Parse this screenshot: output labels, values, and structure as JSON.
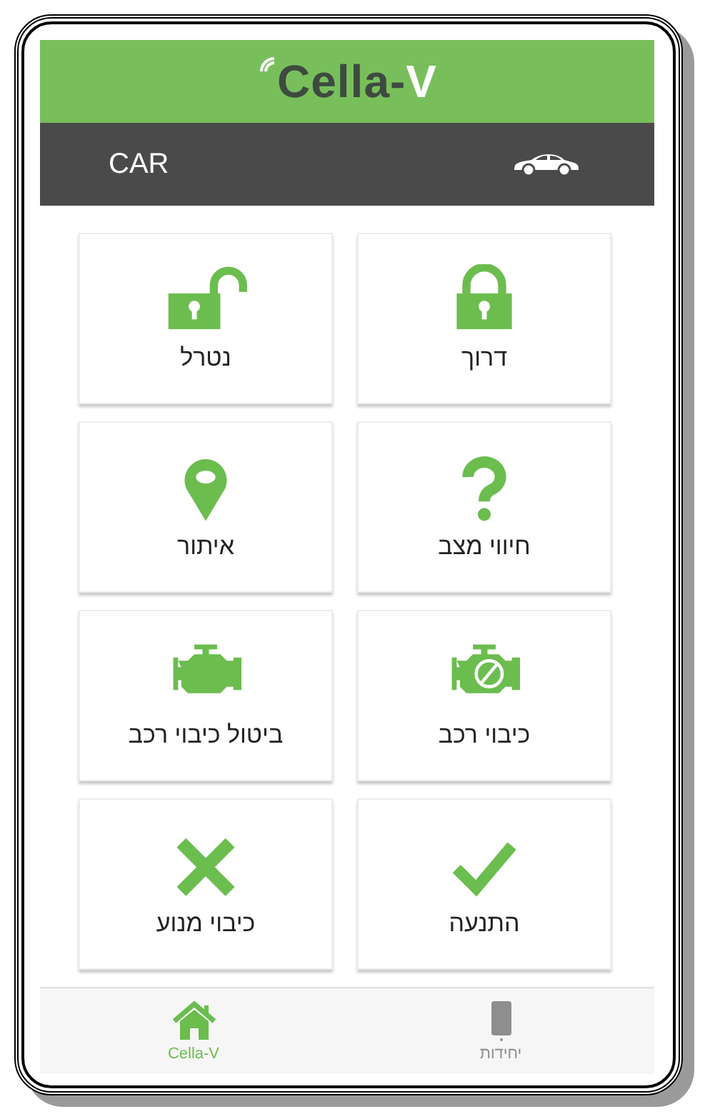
{
  "header": {
    "logo_main": "Cella-",
    "logo_accent": "V"
  },
  "vehicle_bar": {
    "title": "CAR"
  },
  "actions": [
    {
      "label": "דרוך",
      "kind": "lock"
    },
    {
      "label": "נטרל",
      "kind": "unlock"
    },
    {
      "label": "חיווי מצב",
      "kind": "question"
    },
    {
      "label": "איתור",
      "kind": "pin"
    },
    {
      "label": "כיבוי רכב",
      "kind": "engine-off"
    },
    {
      "label": "ביטול כיבוי רכב",
      "kind": "engine"
    },
    {
      "label": "התנעה",
      "kind": "check"
    },
    {
      "label": "כיבוי מנוע",
      "kind": "cross"
    }
  ],
  "tab_bar": [
    {
      "label": "יחידות",
      "kind": "device",
      "selected": false
    },
    {
      "label": "Cella-V",
      "kind": "home",
      "selected": true
    }
  ]
}
